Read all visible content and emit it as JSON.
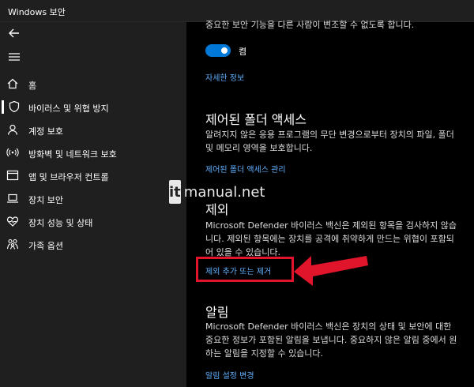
{
  "window": {
    "title": "Windows 보안"
  },
  "sidebar": {
    "items": [
      {
        "label": "홈",
        "icon": "home-icon"
      },
      {
        "label": "바이러스 및 위협 방지",
        "icon": "shield-icon",
        "active": true
      },
      {
        "label": "계정 보호",
        "icon": "person-icon"
      },
      {
        "label": "방화벽 및 네트워크 보호",
        "icon": "wifi-icon"
      },
      {
        "label": "앱 및 브라우저 컨트롤",
        "icon": "browser-icon"
      },
      {
        "label": "장치 보안",
        "icon": "laptop-icon"
      },
      {
        "label": "장치 성능 및 상태",
        "icon": "heart-icon"
      },
      {
        "label": "가족 옵션",
        "icon": "family-icon"
      }
    ]
  },
  "main": {
    "tamper": {
      "description": "중요한 보안 기능을 다른 사람이 변조할 수 없도록 합니다.",
      "toggle_label": "켬",
      "toggle_on": true,
      "more_link": "자세한 정보"
    },
    "folder_access": {
      "heading": "제어된 폴더 액세스",
      "description": "알려지지 않은 응용 프로그램의 무단 변경으로부터 장치의 파일, 폴더 및 메모리 영역을 보호합니다.",
      "link": "제어된 폴더 액세스 관리"
    },
    "exclusions": {
      "heading": "제외",
      "description": "Microsoft Defender 바이러스 백신은 제외된 항목을 검사하지 않습니다. 제외된 항목에는 장치를 공격에 취약하게 만드는 위협이 포함되어 있을 수 있습니다.",
      "link": "제외 추가 또는 제거"
    },
    "notifications": {
      "heading": "알림",
      "description": "Microsoft Defender 바이러스 백신은 장치의 상태 및 보안에 대한 중요한 정보가 포함된 알림을 보냅니다. 중요하지 않은 알림 중에서 원하는 알림을 지정할 수 있습니다.",
      "link": "알림 설정 변경"
    }
  },
  "watermark": {
    "badge": "it",
    "text": "manual.net"
  },
  "colors": {
    "accent": "#0078d7",
    "link": "#5fb0ff",
    "highlight": "#e0142a",
    "sidebar": "#1f1f1f"
  }
}
